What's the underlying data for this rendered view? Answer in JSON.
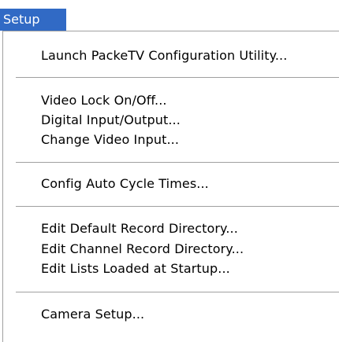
{
  "menu": {
    "title": "Setup",
    "items": [
      {
        "label": "Launch PackeTV Configuration Utility..."
      },
      {
        "label": "Video Lock On/Off..."
      },
      {
        "label": "Digital Input/Output..."
      },
      {
        "label": "Change Video Input..."
      },
      {
        "label": "Config Auto Cycle Times..."
      },
      {
        "label": "Edit Default Record Directory..."
      },
      {
        "label": "Edit Channel Record Directory..."
      },
      {
        "label": "Edit Lists Loaded at Startup..."
      },
      {
        "label": "Camera Setup..."
      }
    ]
  },
  "colors": {
    "highlight": "#316ac5",
    "separator": "#a0a0a0"
  }
}
